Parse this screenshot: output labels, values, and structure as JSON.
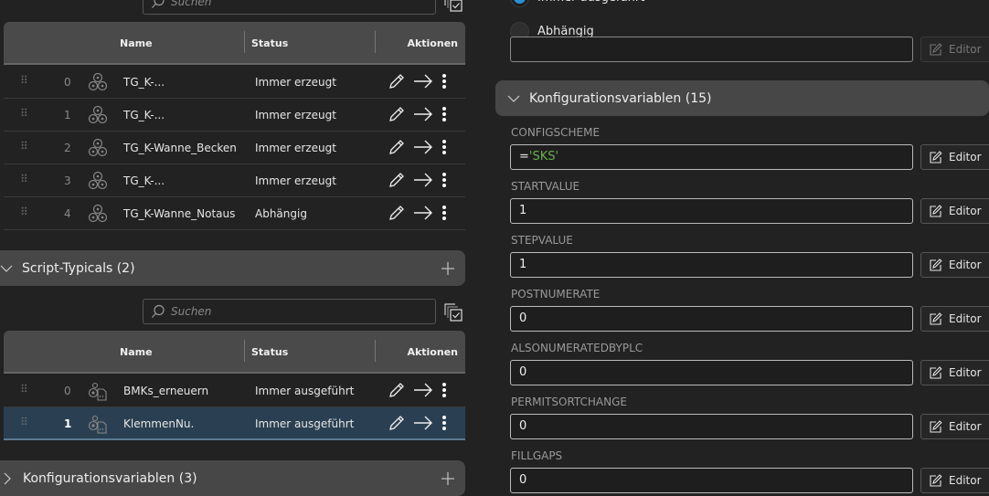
{
  "left": {
    "search_placeholder": "Suchen",
    "table1": {
      "headers": {
        "name": "Name",
        "status": "Status",
        "actions": "Aktionen"
      },
      "rows": [
        {
          "index": "0",
          "name": "TG_K-...",
          "status": "Immer erzeugt"
        },
        {
          "index": "1",
          "name": "TG_K-...",
          "status": "Immer erzeugt"
        },
        {
          "index": "2",
          "name": "TG_K-Wanne_Becken",
          "status": "Immer erzeugt"
        },
        {
          "index": "3",
          "name": "TG_K-...",
          "status": "Immer erzeugt"
        },
        {
          "index": "4",
          "name": "TG_K-Wanne_Notaus",
          "status": "Abhängig"
        }
      ]
    },
    "script_section": "Script-Typicals (2)",
    "table2": {
      "headers": {
        "name": "Name",
        "status": "Status",
        "actions": "Aktionen"
      },
      "rows": [
        {
          "index": "0",
          "name": "BMKs_erneuern",
          "status": "Immer ausgeführt"
        },
        {
          "index": "1",
          "name": "KlemmenNu.",
          "status": "Immer ausgeführt",
          "selected": true
        }
      ]
    },
    "config_section": "Konfigurationsvariablen (3)"
  },
  "right": {
    "radio_options": [
      "Immer ausgeführt",
      "Abhängig"
    ],
    "selected_radio": "Immer ausgeführt",
    "condition_value": "",
    "editor_label": "Editor",
    "config_section": "Konfigurationsvariablen (15)",
    "vars": [
      {
        "name": "CONFIGSCHEME",
        "prefix": "=",
        "value": "'SKS'"
      },
      {
        "name": "STARTVALUE",
        "prefix": "",
        "value": "1"
      },
      {
        "name": "STEPVALUE",
        "prefix": "",
        "value": "1"
      },
      {
        "name": "POSTNUMERATE",
        "prefix": "",
        "value": "0"
      },
      {
        "name": "ALSONUMERATEDBYPLC",
        "prefix": "",
        "value": "0"
      },
      {
        "name": "PERMITSORTCHANGE",
        "prefix": "",
        "value": "0"
      },
      {
        "name": "FILLGAPS",
        "prefix": "",
        "value": "0"
      }
    ],
    "colors": {
      "string_literal": "#6ab04c",
      "accent": "#2a8fd8"
    }
  }
}
